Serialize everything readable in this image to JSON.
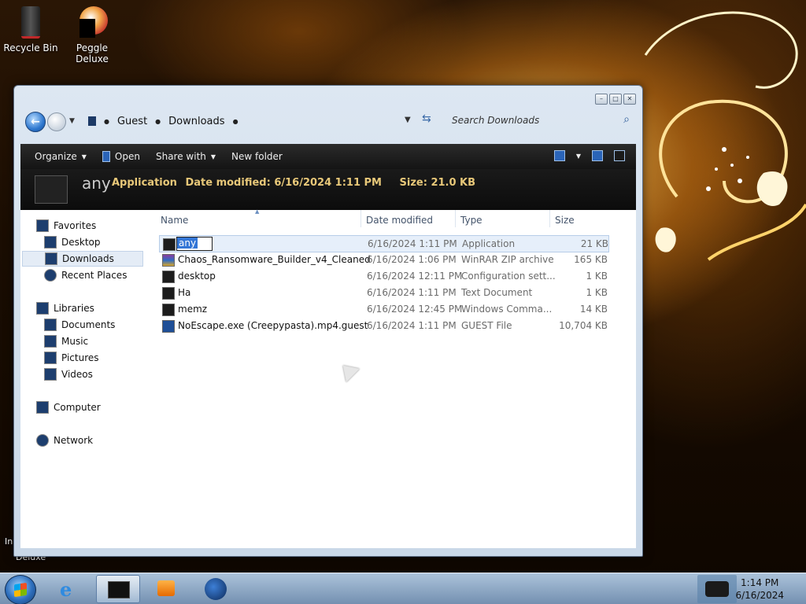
{
  "desktop": {
    "icons": [
      {
        "label": "Recycle Bin",
        "icon": "recycle-bin-icon"
      },
      {
        "label": "Peggle Deluxe",
        "icon": "peggle-icon"
      }
    ],
    "partial_labels": [
      "In",
      "Deluxe"
    ]
  },
  "window": {
    "controls": [
      "minimize",
      "maximize",
      "close"
    ],
    "address": {
      "crumbs": [
        "Guest",
        "Downloads"
      ],
      "search_placeholder": "Search Downloads"
    },
    "toolbar": {
      "organize": "Organize",
      "open": "Open",
      "share_with": "Share with",
      "new_folder": "New folder"
    },
    "details": {
      "name": "any",
      "type": "Application",
      "modified_label": "Date modified:",
      "modified_value": "6/16/2024 1:11 PM",
      "size_label": "Size:",
      "size_value": "21.0 KB"
    },
    "nav": {
      "favorites": "Favorites",
      "desktop": "Desktop",
      "downloads": "Downloads",
      "recent": "Recent Places",
      "libraries": "Libraries",
      "documents": "Documents",
      "music": "Music",
      "pictures": "Pictures",
      "videos": "Videos",
      "computer": "Computer",
      "network": "Network"
    },
    "columns": {
      "name": "Name",
      "date": "Date modified",
      "type": "Type",
      "size": "Size"
    },
    "files": [
      {
        "name": "any",
        "date": "6/16/2024 1:11 PM",
        "type": "Application",
        "size": "21 KB"
      },
      {
        "name": "Chaos_Ransomware_Builder_v4_Cleaned",
        "date": "6/16/2024 1:06 PM",
        "type": "WinRAR ZIP archive",
        "size": "165 KB"
      },
      {
        "name": "desktop",
        "date": "6/16/2024 12:11 PM",
        "type": "Configuration sett...",
        "size": "1 KB"
      },
      {
        "name": "Ha",
        "date": "6/16/2024 1:11 PM",
        "type": "Text Document",
        "size": "1 KB"
      },
      {
        "name": "memz",
        "date": "6/16/2024 12:45 PM",
        "type": "Windows Comma...",
        "size": "14 KB"
      },
      {
        "name": "NoEscape.exe (Creepypasta).mp4.guest",
        "date": "6/16/2024 1:11 PM",
        "type": "GUEST File",
        "size": "10,704 KB"
      }
    ]
  },
  "taskbar": {
    "time": "1:14 PM",
    "date": "6/16/2024"
  }
}
